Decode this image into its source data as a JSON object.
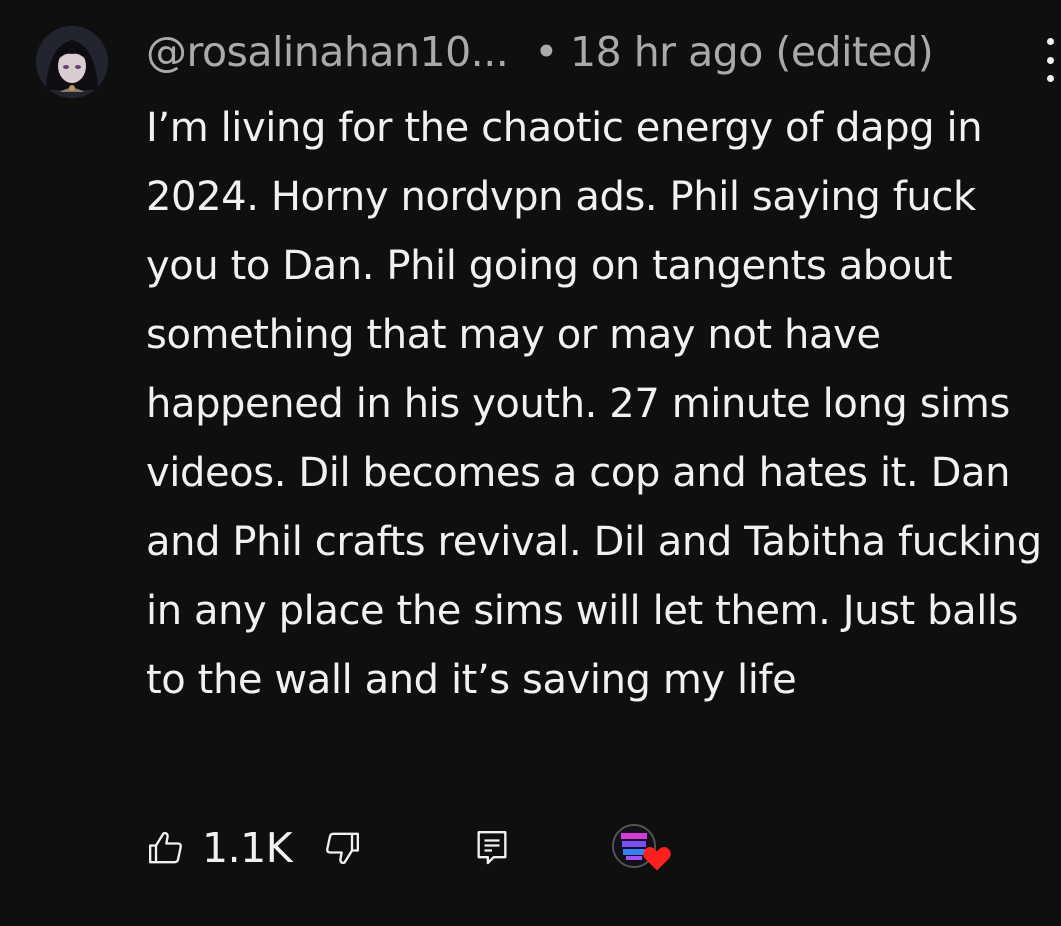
{
  "comment": {
    "author": "@rosalinahan10...",
    "separator": "•",
    "timestamp": "18 hr ago (edited)",
    "text": "I’m living for the chaotic energy of dapg in 2024. Horny nordvpn ads. Phil saying fuck you to Dan. Phil going on tangents about something that may or may not have happened in his youth. 27 minute long sims videos. Dil becomes a cop and hates it. Dan and Phil crafts revival. Dil and Tabitha fucking in any place the sims will let them. Just balls to the wall and it’s saving my life",
    "likes": "1.1K"
  },
  "icons": {
    "avatar": "user-avatar-anime-girl",
    "more": "more-vertical-icon",
    "like": "thumbs-up-icon",
    "dislike": "thumbs-down-icon",
    "reply": "comment-reply-icon",
    "creator_heart": "creator-heart-badge"
  },
  "colors": {
    "background": "#0f0f0f",
    "text": "#f1f1f1",
    "meta": "#aaaaaa",
    "heart": "#ff1f1f"
  }
}
